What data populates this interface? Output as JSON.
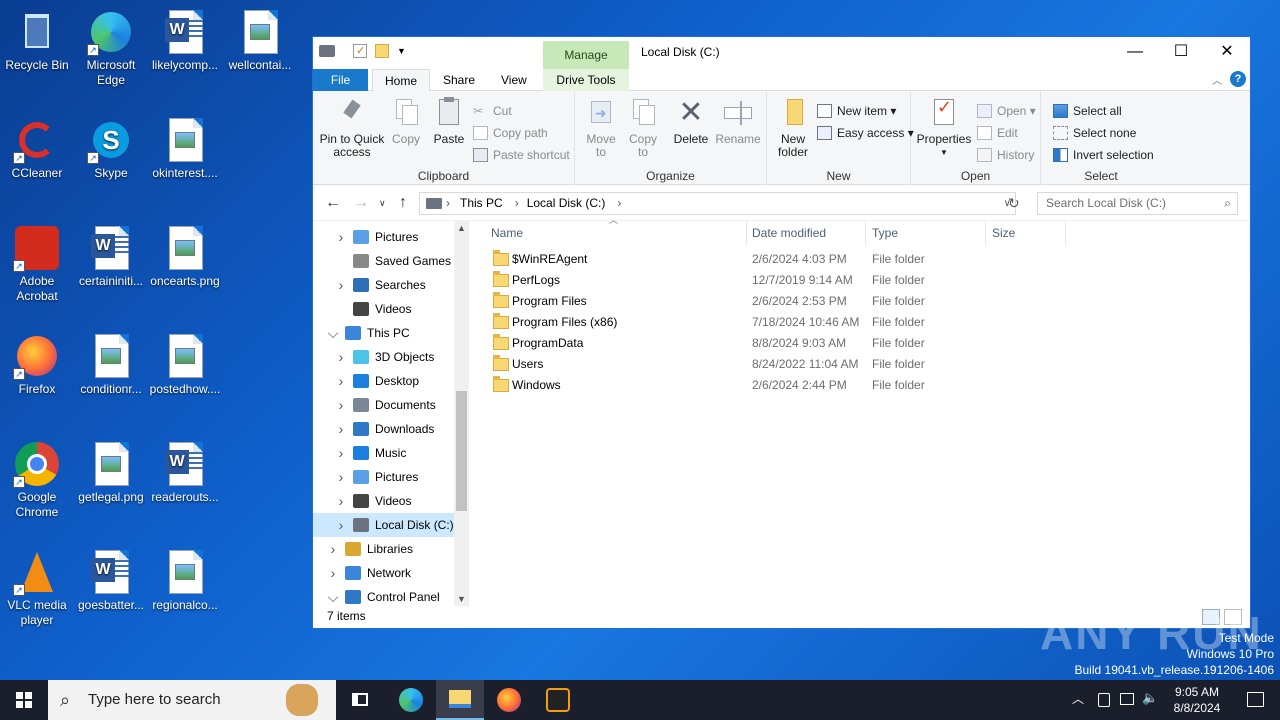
{
  "desktop": {
    "icons": [
      {
        "label": "Recycle Bin",
        "icon": "recycle-bin-icon"
      },
      {
        "label": "Microsoft Edge",
        "icon": "edge-icon"
      },
      {
        "label": "likelycomp...",
        "icon": "word-doc-icon"
      },
      {
        "label": "wellcontai...",
        "icon": "image-file-icon"
      },
      {
        "label": "CCleaner",
        "icon": "ccleaner-icon"
      },
      {
        "label": "Skype",
        "icon": "skype-icon"
      },
      {
        "label": "okinterest....",
        "icon": "image-file-icon"
      },
      {
        "label": "Adobe Acrobat",
        "icon": "acrobat-icon"
      },
      {
        "label": "certaininiti...",
        "icon": "word-doc-icon"
      },
      {
        "label": "oncearts.png",
        "icon": "image-file-icon"
      },
      {
        "label": "Firefox",
        "icon": "firefox-icon"
      },
      {
        "label": "conditionr...",
        "icon": "image-file-icon"
      },
      {
        "label": "postedhow....",
        "icon": "image-file-icon"
      },
      {
        "label": "Google Chrome",
        "icon": "chrome-icon"
      },
      {
        "label": "getlegal.png",
        "icon": "image-file-icon"
      },
      {
        "label": "readerouts...",
        "icon": "word-doc-icon"
      },
      {
        "label": "VLC media player",
        "icon": "vlc-icon"
      },
      {
        "label": "goesbatter...",
        "icon": "word-doc-icon"
      },
      {
        "label": "regionalco...",
        "icon": "image-file-icon"
      }
    ]
  },
  "window": {
    "title": "Local Disk (C:)",
    "context_tab": "Manage",
    "tabs": {
      "file": "File",
      "home": "Home",
      "share": "Share",
      "view": "View",
      "drive_tools": "Drive Tools"
    },
    "ribbon": {
      "clipboard": {
        "label": "Clipboard",
        "pin": "Pin to Quick access",
        "copy": "Copy",
        "paste": "Paste",
        "cut": "Cut",
        "copy_path": "Copy path",
        "paste_shortcut": "Paste shortcut"
      },
      "organize": {
        "label": "Organize",
        "move_to": "Move to",
        "copy_to": "Copy to",
        "delete": "Delete",
        "rename": "Rename"
      },
      "new": {
        "label": "New",
        "new_folder": "New folder",
        "new_item": "New item",
        "easy_access": "Easy access"
      },
      "open": {
        "label": "Open",
        "properties": "Properties",
        "open": "Open",
        "edit": "Edit",
        "history": "History"
      },
      "select": {
        "label": "Select",
        "select_all": "Select all",
        "select_none": "Select none",
        "invert": "Invert selection"
      }
    },
    "address": {
      "crumbs": [
        "This PC",
        "Local Disk (C:)"
      ],
      "search_placeholder": "Search Local Disk (C:)"
    },
    "nav": [
      {
        "label": "Pictures",
        "indent": 1,
        "chevron": ">"
      },
      {
        "label": "Saved Games",
        "indent": 1,
        "chevron": ""
      },
      {
        "label": "Searches",
        "indent": 1,
        "chevron": ">"
      },
      {
        "label": "Videos",
        "indent": 1,
        "chevron": ""
      },
      {
        "label": "This PC",
        "indent": 0,
        "chevron": "v"
      },
      {
        "label": "3D Objects",
        "indent": 1,
        "chevron": ">"
      },
      {
        "label": "Desktop",
        "indent": 1,
        "chevron": ">"
      },
      {
        "label": "Documents",
        "indent": 1,
        "chevron": ">"
      },
      {
        "label": "Downloads",
        "indent": 1,
        "chevron": ">"
      },
      {
        "label": "Music",
        "indent": 1,
        "chevron": ">"
      },
      {
        "label": "Pictures",
        "indent": 1,
        "chevron": ">"
      },
      {
        "label": "Videos",
        "indent": 1,
        "chevron": ">"
      },
      {
        "label": "Local Disk (C:)",
        "indent": 1,
        "chevron": ">",
        "selected": true
      },
      {
        "label": "Libraries",
        "indent": 0,
        "chevron": ">"
      },
      {
        "label": "Network",
        "indent": 0,
        "chevron": ">"
      },
      {
        "label": "Control Panel",
        "indent": 0,
        "chevron": "v"
      }
    ],
    "columns": {
      "name": "Name",
      "date": "Date modified",
      "type": "Type",
      "size": "Size"
    },
    "files": [
      {
        "name": "$WinREAgent",
        "date": "2/6/2024 4:03 PM",
        "type": "File folder"
      },
      {
        "name": "PerfLogs",
        "date": "12/7/2019 9:14 AM",
        "type": "File folder"
      },
      {
        "name": "Program Files",
        "date": "2/6/2024 2:53 PM",
        "type": "File folder"
      },
      {
        "name": "Program Files (x86)",
        "date": "7/18/2024 10:46 AM",
        "type": "File folder"
      },
      {
        "name": "ProgramData",
        "date": "8/8/2024 9:03 AM",
        "type": "File folder"
      },
      {
        "name": "Users",
        "date": "8/24/2022 11:04 AM",
        "type": "File folder"
      },
      {
        "name": "Windows",
        "date": "2/6/2024 2:44 PM",
        "type": "File folder"
      }
    ],
    "status": "7 items"
  },
  "watermark": {
    "line1": "Test Mode",
    "line2": "Windows 10 Pro",
    "line3": "Build 19041.vb_release.191206-1406",
    "brand": "ANY RUN"
  },
  "taskbar": {
    "search_placeholder": "Type here to search",
    "time": "9:05 AM",
    "date": "8/8/2024"
  },
  "colors": {
    "accent": "#1979ca",
    "manage_tab": "#c7e8b9",
    "selection": "#cce8ff",
    "taskbar": "#1b1e2b"
  }
}
